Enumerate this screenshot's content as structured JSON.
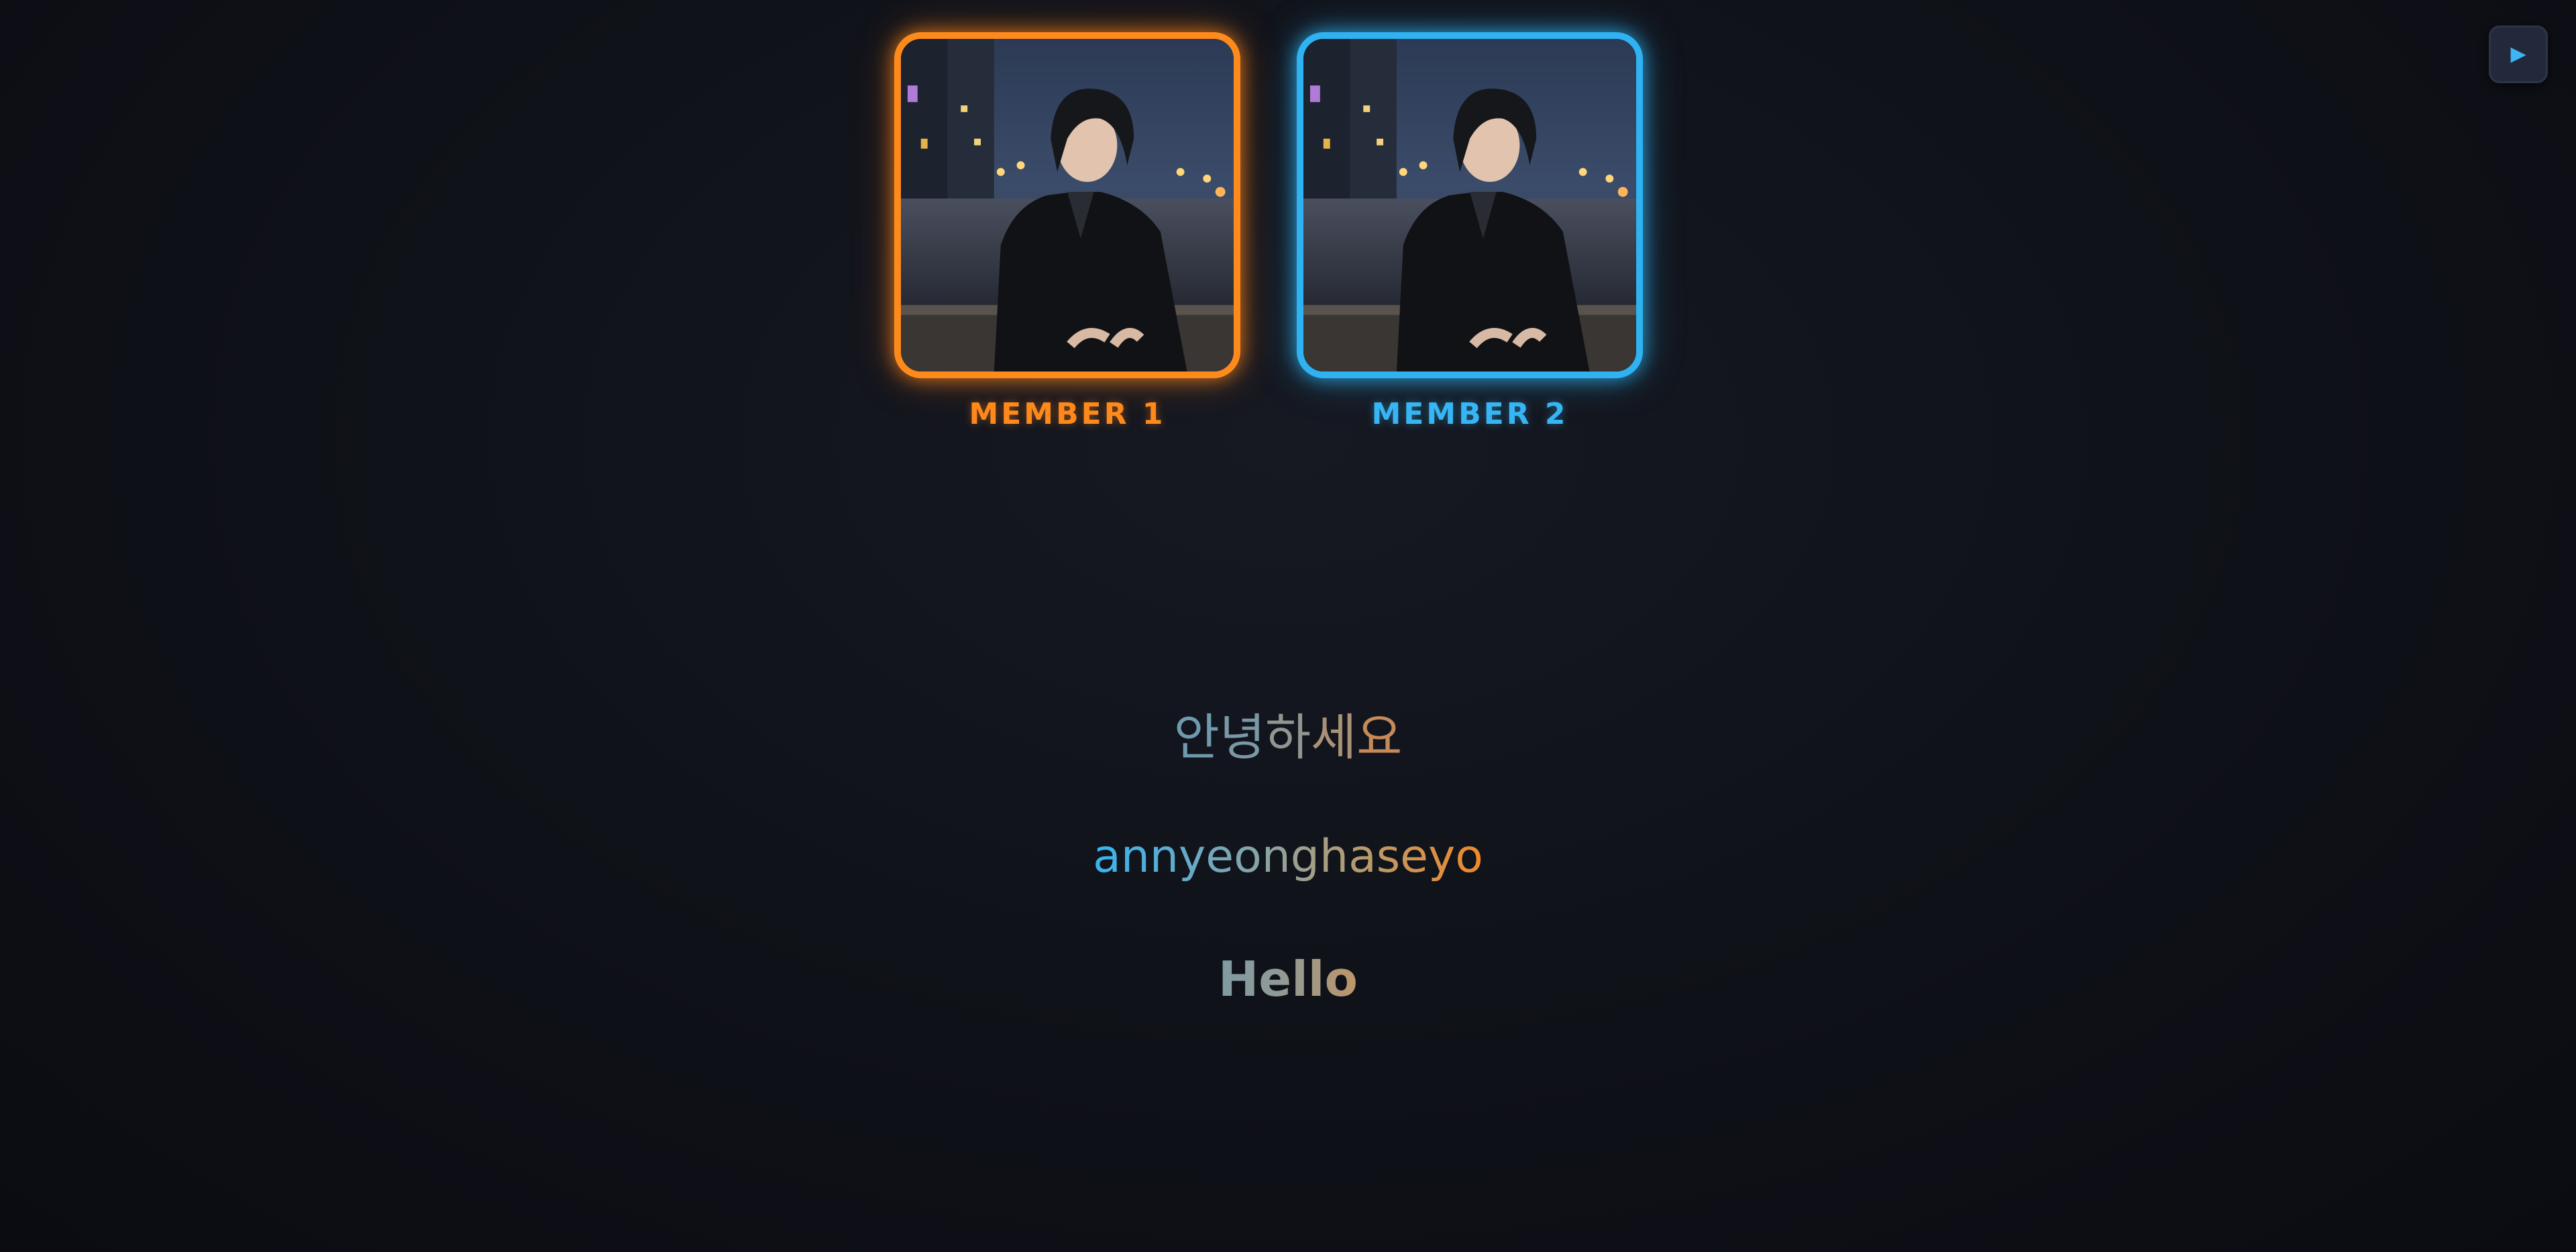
{
  "members": [
    {
      "label": "MEMBER 1",
      "accent": "#ff8a1c",
      "photo": "portrait of member in dark jacket on city street at night"
    },
    {
      "label": "MEMBER 2",
      "accent": "#2fb2f2",
      "photo": "portrait of member in dark jacket on city street at night"
    }
  ],
  "controls": {
    "play_icon": "play-icon",
    "play_glyph": "▶"
  },
  "phrase": {
    "korean_chars": [
      "안",
      "녕",
      "하",
      "세",
      "요"
    ],
    "romanization": "annyeonghaseyo",
    "english": "Hello"
  },
  "colors": {
    "orange": "#ff8a1c",
    "blue": "#2fb2f2",
    "background": "#0f1118"
  }
}
